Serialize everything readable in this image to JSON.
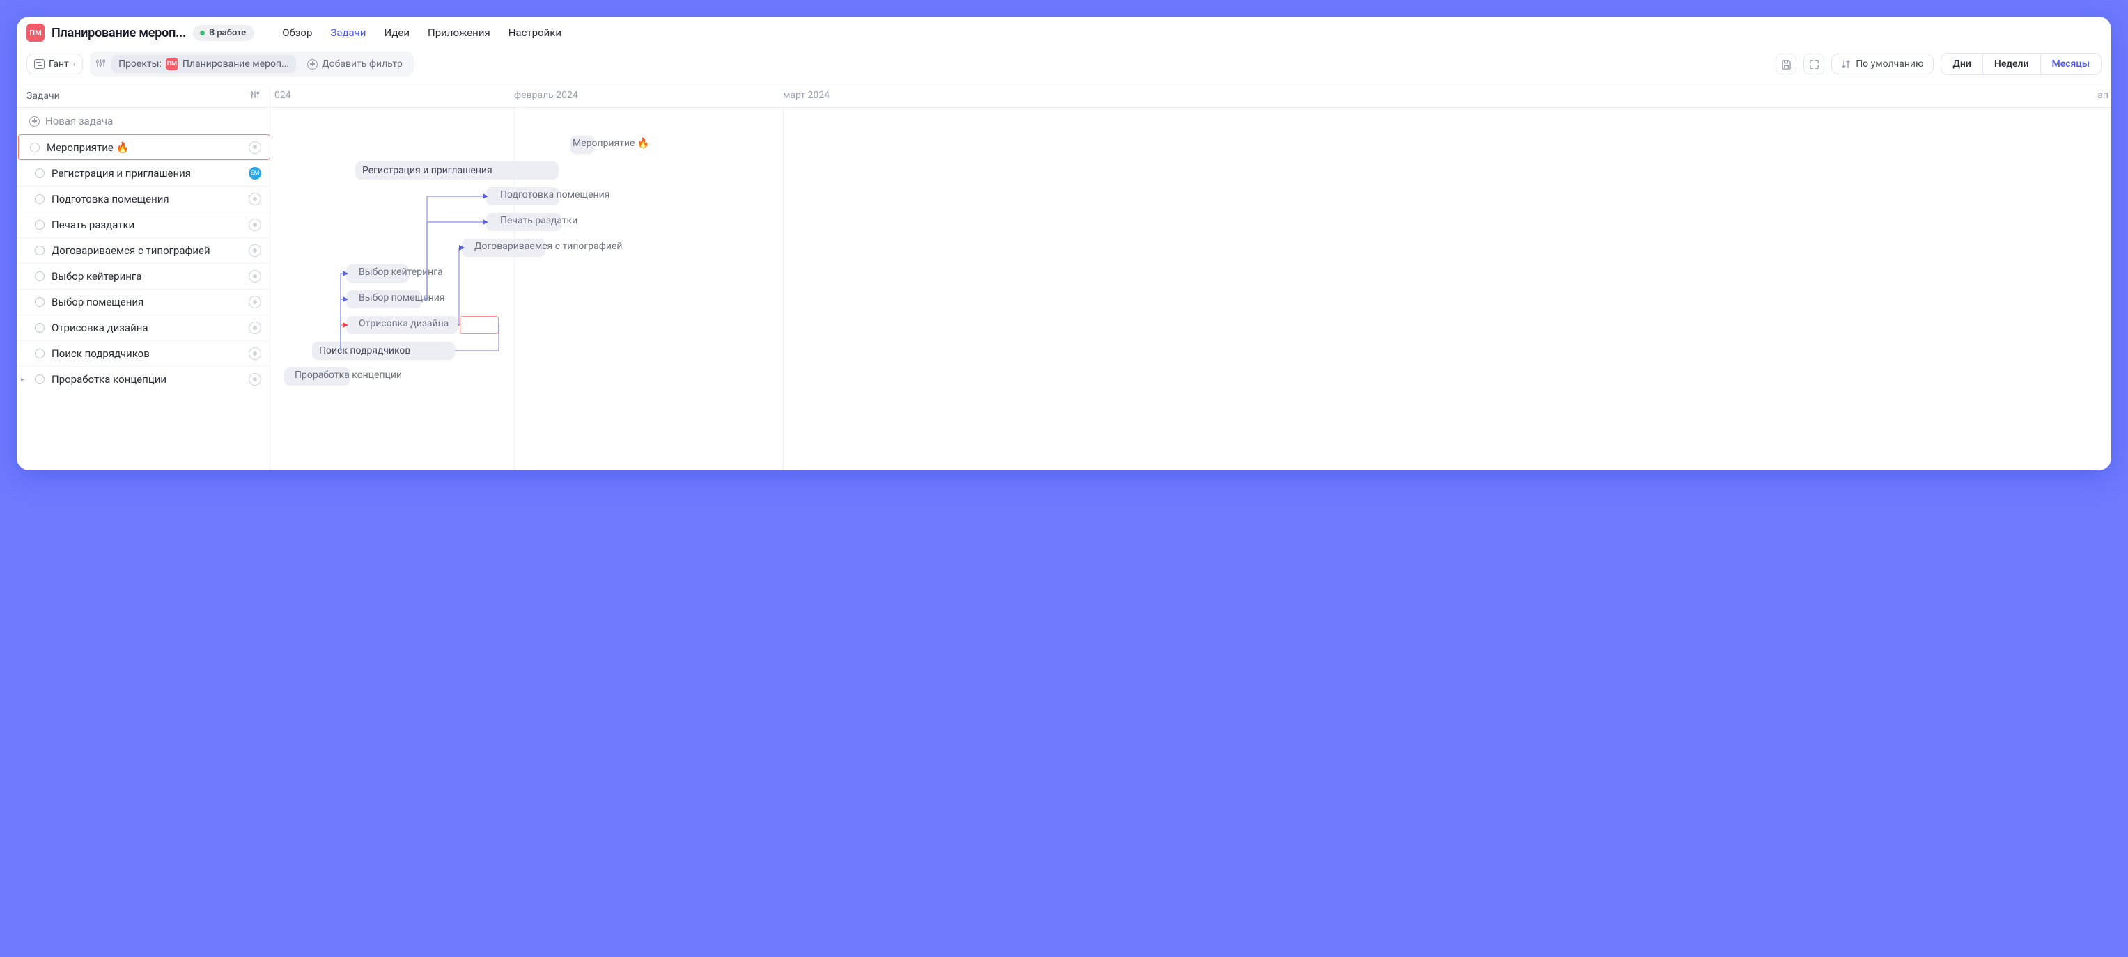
{
  "header": {
    "project_badge": "ПМ",
    "project_title": "Планирование мероп...",
    "status_label": "В работе",
    "nav": {
      "overview": "Обзор",
      "tasks": "Задачи",
      "ideas": "Идеи",
      "apps": "Приложения",
      "settings": "Настройки"
    }
  },
  "toolbar": {
    "view_label": "Гант",
    "filters_label": "Проекты:",
    "filter_chip_badge": "ПМ",
    "filter_chip_text": "Планирование мероп...",
    "add_filter": "Добавить фильтр",
    "sort_label": "По умолчанию",
    "zoom": {
      "days": "Дни",
      "weeks": "Недели",
      "months": "Месяцы"
    }
  },
  "side": {
    "heading": "Задачи",
    "new_task": "Новая задача"
  },
  "tasks": [
    {
      "label": "Мероприятие 🔥",
      "highlight": true,
      "assignee": null
    },
    {
      "label": "Регистрация и приглашения",
      "assignee": "ЕМ"
    },
    {
      "label": "Подготовка помещения"
    },
    {
      "label": "Печать раздатки"
    },
    {
      "label": "Договариваемся с типографией"
    },
    {
      "label": "Выбор кейтеринга"
    },
    {
      "label": "Выбор помещения"
    },
    {
      "label": "Отрисовка дизайна"
    },
    {
      "label": "Поиск подрядчиков"
    },
    {
      "label": "Проработка концепции",
      "caret": true
    }
  ],
  "timeline": {
    "head_left": "024",
    "head_center": "февраль 2024",
    "head_right": "март 2024",
    "head_far": "ап"
  },
  "bars": {
    "event": "Мероприятие 🔥",
    "registration": "Регистрация и приглашения",
    "venue_prep": "Подготовка помещения",
    "printing": "Печать раздатки",
    "typography": "Договариваемся с типографией",
    "catering": "Выбор кейтеринга",
    "venue_sel": "Выбор помещения",
    "design": "Отрисовка дизайна",
    "contractors": "Поиск подрядчиков",
    "concept": "Проработка концепции"
  }
}
